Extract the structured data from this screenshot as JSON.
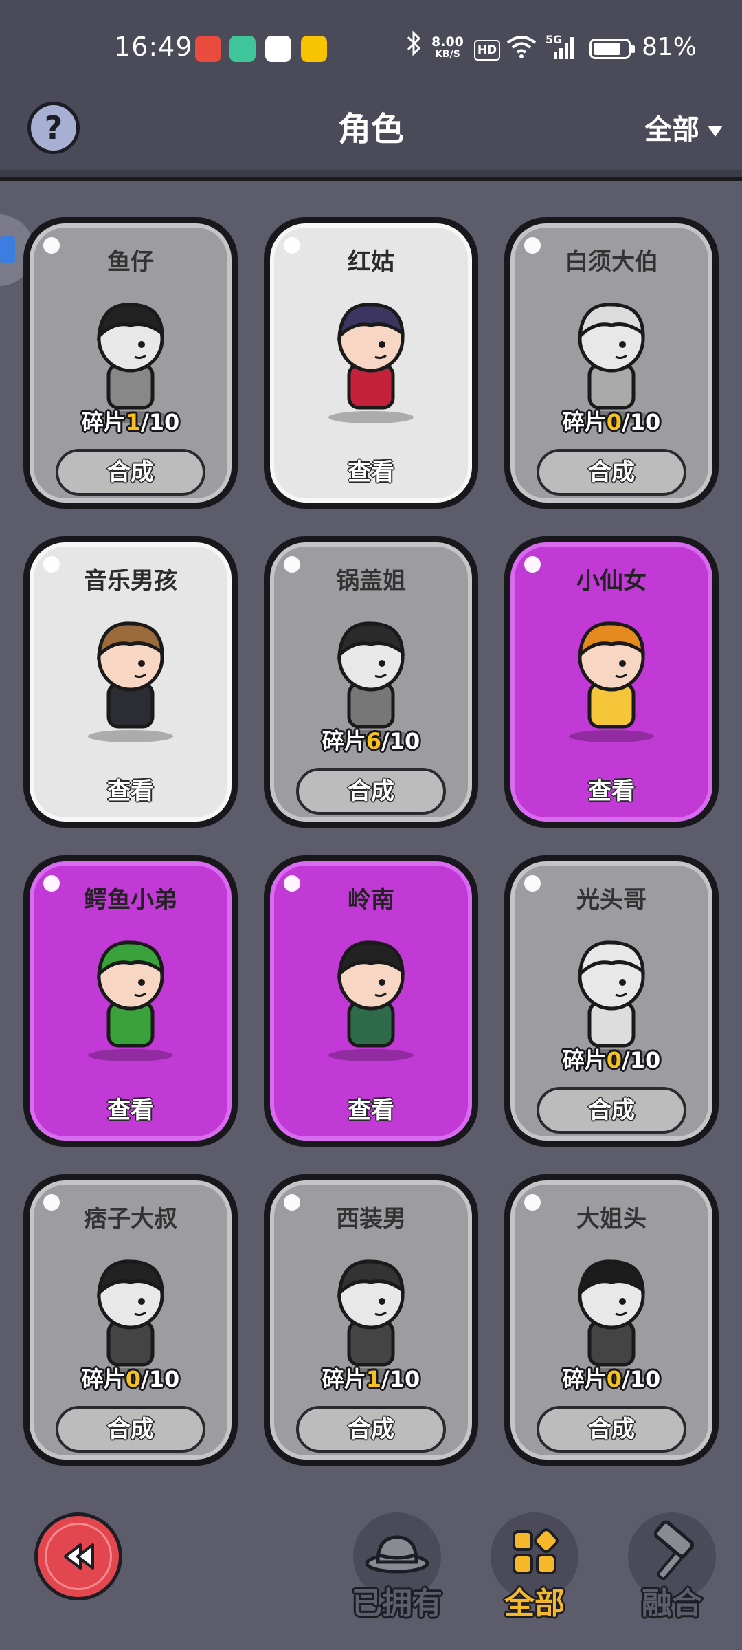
{
  "status_bar": {
    "time": "16:49",
    "net_speed_value": "8.00",
    "net_speed_unit": "KB/S",
    "hd": "HD",
    "signal": "5G",
    "battery_percent": "81%",
    "battery_level": 0.81
  },
  "header": {
    "help_icon": "question-mark-icon",
    "help_glyph": "?",
    "title": "角色",
    "filter_label": "全部"
  },
  "cards": [
    {
      "name": "鱼仔",
      "state": "locked",
      "shard_label": "碎片",
      "shard_count": "1",
      "shard_total": "/10",
      "button": "合成"
    },
    {
      "name": "红姑",
      "state": "owned",
      "button": "查看"
    },
    {
      "name": "白须大伯",
      "state": "locked",
      "shard_label": "碎片",
      "shard_count": "0",
      "shard_total": "/10",
      "button": "合成"
    },
    {
      "name": "音乐男孩",
      "state": "owned",
      "button": "查看"
    },
    {
      "name": "锅盖姐",
      "state": "locked",
      "shard_label": "碎片",
      "shard_count": "6",
      "shard_total": "/10",
      "button": "合成"
    },
    {
      "name": "小仙女",
      "state": "owned-rare",
      "button": "查看"
    },
    {
      "name": "鳄鱼小弟",
      "state": "owned-rare",
      "button": "查看"
    },
    {
      "name": "岭南",
      "state": "owned-rare",
      "button": "查看"
    },
    {
      "name": "光头哥",
      "state": "locked",
      "shard_label": "碎片",
      "shard_count": "0",
      "shard_total": "/10",
      "button": "合成"
    },
    {
      "name": "痞子大叔",
      "state": "locked",
      "shard_label": "碎片",
      "shard_count": "0",
      "shard_total": "/10",
      "button": "合成"
    },
    {
      "name": "西装男",
      "state": "locked",
      "shard_label": "碎片",
      "shard_count": "1",
      "shard_total": "/10",
      "button": "合成"
    },
    {
      "name": "大姐头",
      "state": "locked",
      "shard_label": "碎片",
      "shard_count": "0",
      "shard_total": "/10",
      "button": "合成"
    }
  ],
  "bottom_nav": {
    "back_icon": "rewind-back-icon",
    "tabs": [
      {
        "label": "已拥有",
        "icon": "bowler-hat-icon"
      },
      {
        "label": "全部",
        "icon": "grid-icon",
        "active": true
      },
      {
        "label": "融合",
        "icon": "hammer-icon"
      }
    ]
  },
  "colors": {
    "background": "#5c5c6b",
    "card_purple": "#c23ad6",
    "card_gray": "#9d9da1",
    "card_white": "#e6e6e6",
    "accent_gold": "#f5b82a",
    "back_red": "#e2464e"
  }
}
